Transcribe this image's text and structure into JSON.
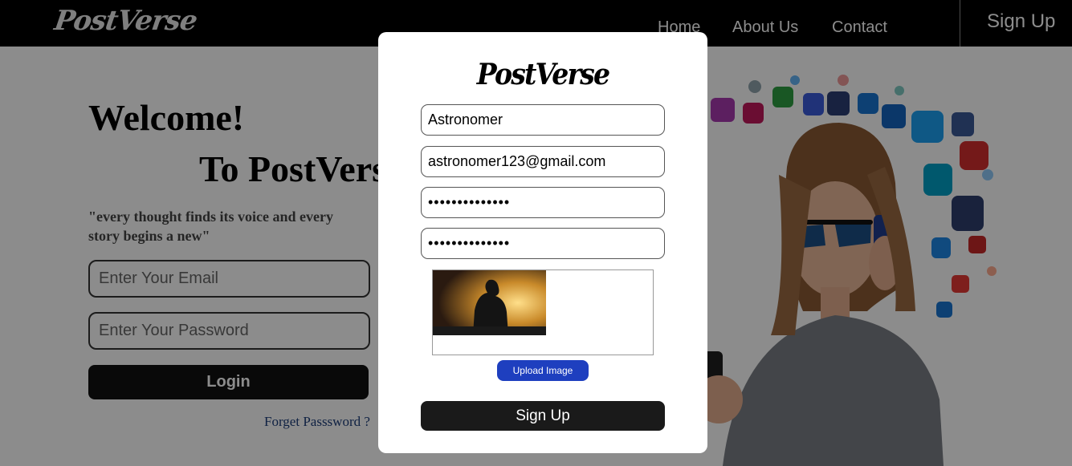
{
  "navbar": {
    "brand": "PostVerse",
    "links": [
      "Home",
      "About Us",
      "Contact"
    ],
    "signup_label": "Sign Up"
  },
  "hero": {
    "welcome": "Welcome!",
    "to_brand": "To PostVerse",
    "tagline": "\"every thought finds its voice and every story begins a new\"",
    "email_placeholder": "Enter Your Email",
    "password_placeholder": "Enter Your Password",
    "login_label": "Login",
    "forgot_label": "Forget Passsword ?"
  },
  "modal": {
    "brand": "PostVerse",
    "name_value": "Astronomer",
    "email_value": "astronomer123@gmail.com",
    "password_value": "••••••••••••••",
    "confirm_value": "••••••••••••••",
    "upload_label": "Upload Image",
    "signup_label": "Sign Up"
  },
  "colors": {
    "navbar_bg": "#000000",
    "overlay": "rgba(0,0,0,0.45)",
    "upload_button": "#1e3fbf",
    "signup_button": "#1a1a1a"
  }
}
